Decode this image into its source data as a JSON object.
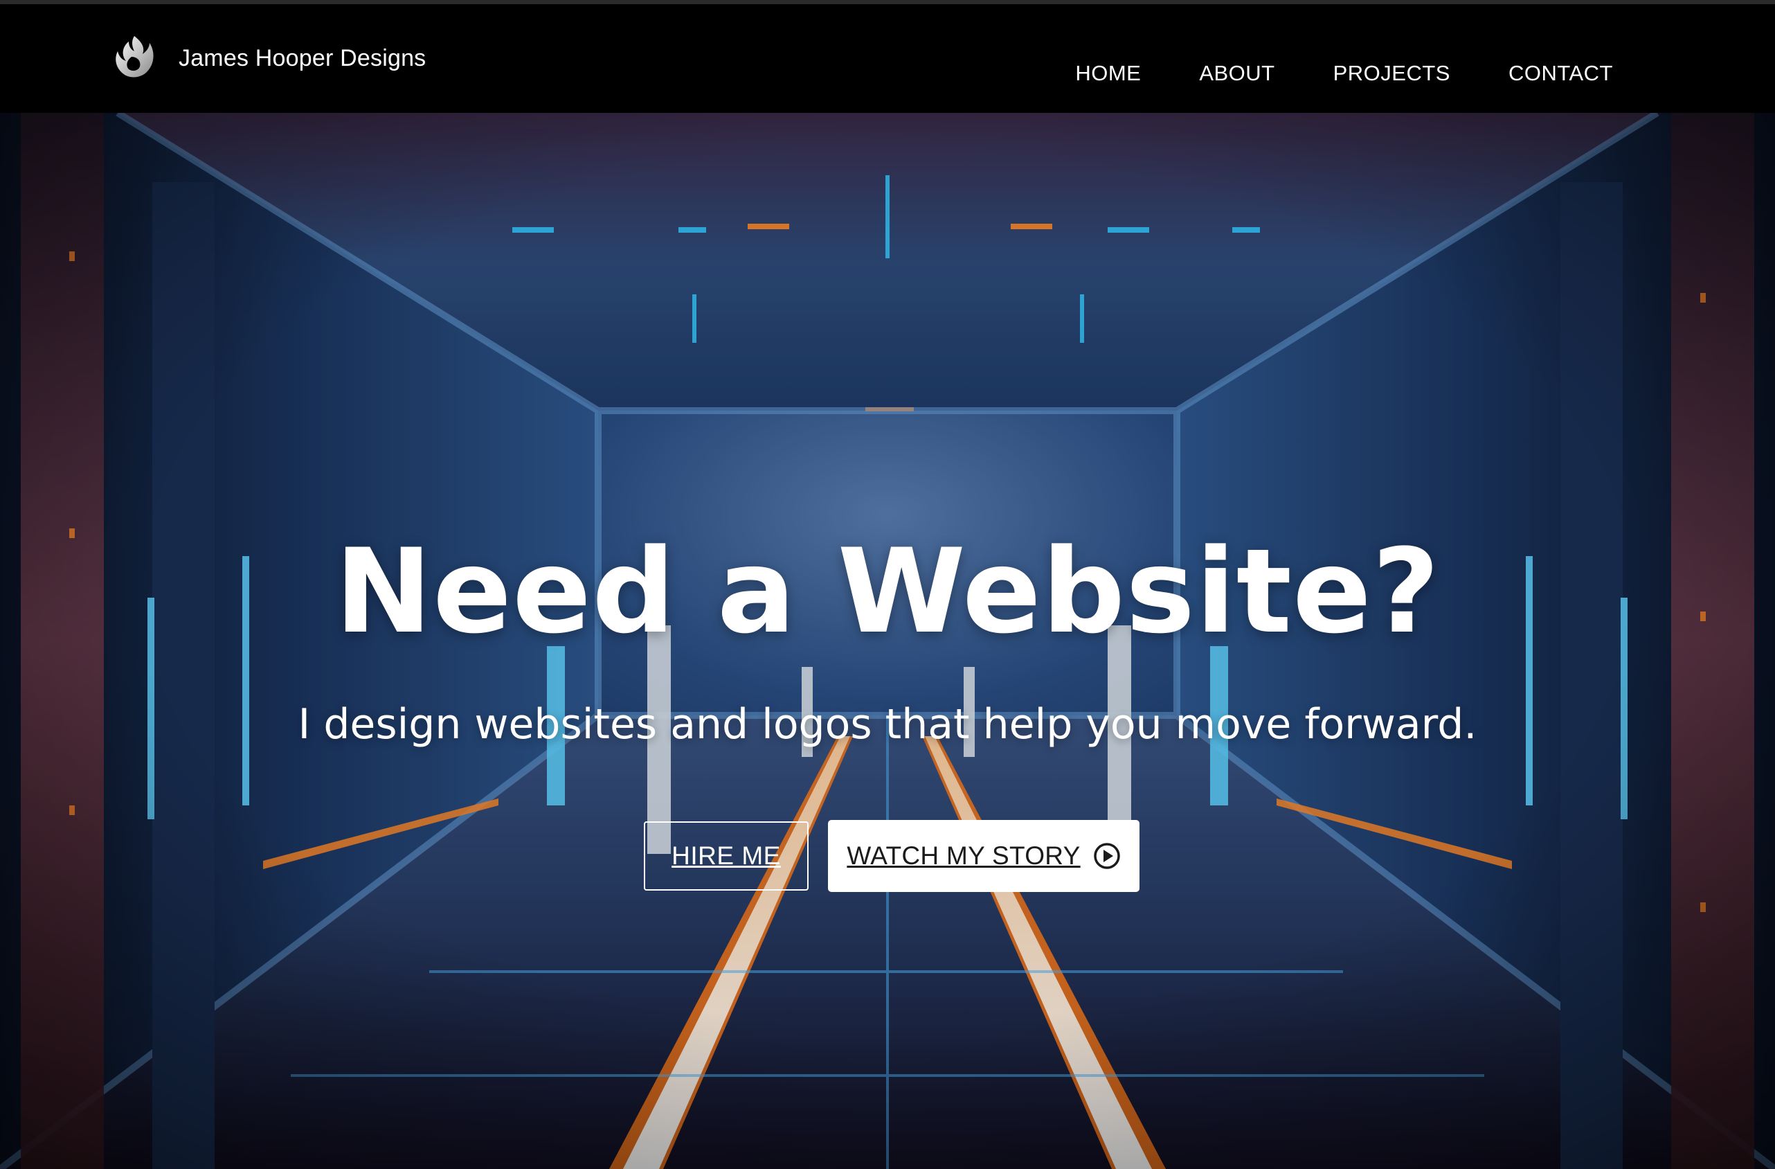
{
  "header": {
    "brand_name": "James Hooper Designs",
    "logo_icon": "flame-swirl-logo-icon"
  },
  "nav": {
    "items": [
      {
        "label": "HOME"
      },
      {
        "label": "ABOUT"
      },
      {
        "label": "PROJECTS"
      },
      {
        "label": "CONTACT"
      }
    ]
  },
  "hero": {
    "title": "Need a Website?",
    "subtitle": "I design websites and logos that help you move forward.",
    "hire_label": "HIRE ME",
    "story_label": "WATCH MY STORY",
    "story_icon": "play-circle-icon",
    "background": "neon-sci-fi-corridor"
  },
  "colors": {
    "header_bg": "#000000",
    "text": "#ffffff",
    "neon_blue": "#35c8ff",
    "neon_orange": "#ff8a2a",
    "corridor_dark": "#0b1a33",
    "button_text_dark": "#1b1b1b"
  }
}
